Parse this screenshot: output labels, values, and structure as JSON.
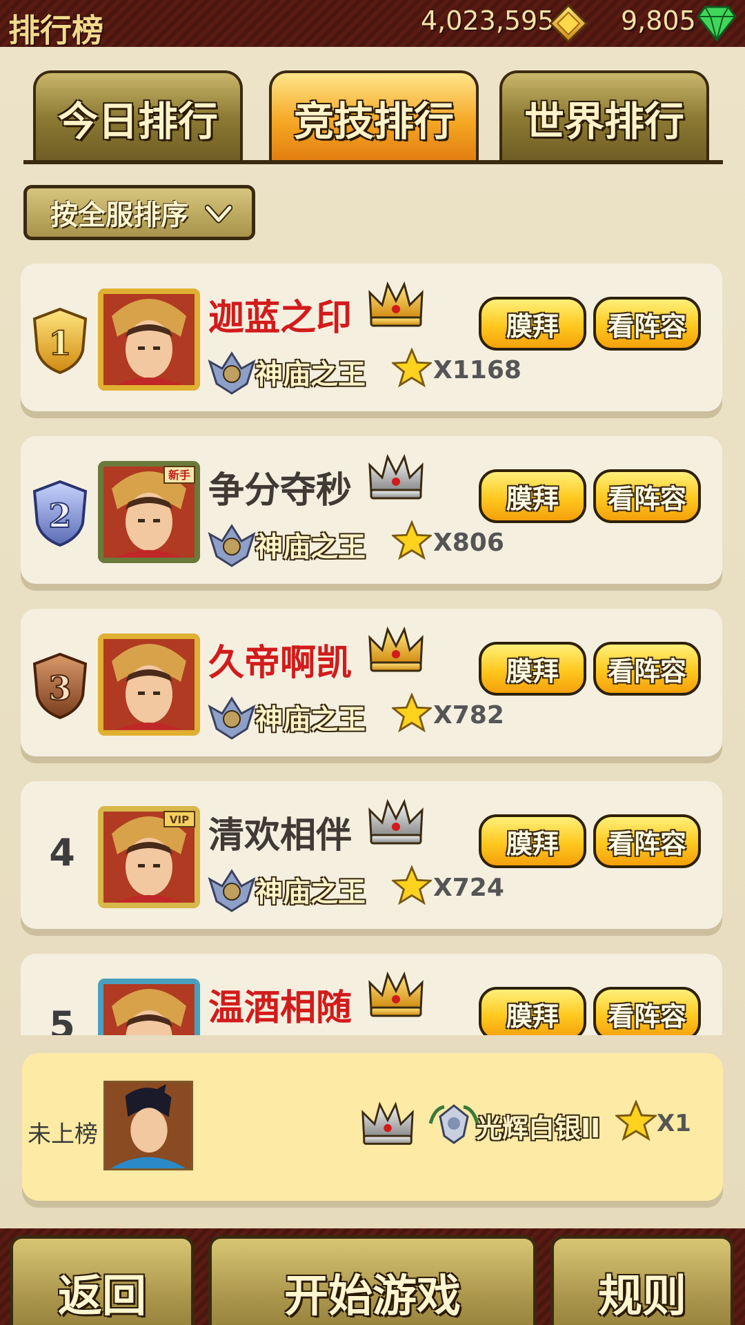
{
  "header": {
    "title": "排行榜",
    "gold": "4,023,595",
    "gems": "9,805"
  },
  "tabs": [
    {
      "label": "今日排行",
      "active": false
    },
    {
      "label": "竞技排行",
      "active": true
    },
    {
      "label": "世界排行",
      "active": false
    }
  ],
  "filter": {
    "selected": "按全服排序"
  },
  "rankings": [
    {
      "rank": "1",
      "name": "迦蓝之印",
      "name_color": "red",
      "crown": "gold-crown-icon",
      "title": "神庙之王",
      "stars": "X1168",
      "worship_label": "膜拜",
      "lineup_label": "看阵容"
    },
    {
      "rank": "2",
      "name": "争分夺秒",
      "name_color": "grey",
      "crown": "silver-crown-icon",
      "title": "神庙之王",
      "stars": "X806",
      "worship_label": "膜拜",
      "lineup_label": "看阵容",
      "avatar_badge": "新手"
    },
    {
      "rank": "3",
      "name": "久帝啊凯",
      "name_color": "red",
      "crown": "gold-crown-icon",
      "title": "神庙之王",
      "stars": "X782",
      "worship_label": "膜拜",
      "lineup_label": "看阵容"
    },
    {
      "rank": "4",
      "name": "清欢相伴",
      "name_color": "grey",
      "crown": "silver-crown-icon",
      "title": "神庙之王",
      "stars": "X724",
      "worship_label": "膜拜",
      "lineup_label": "看阵容",
      "avatar_badge": "VIP"
    },
    {
      "rank": "5",
      "name": "温酒相随",
      "name_color": "red",
      "crown": "gold-crown-icon",
      "worship_label": "膜拜",
      "lineup_label": "看阵容"
    }
  ],
  "my_rank": {
    "status": "未上榜",
    "crown": "silver-crown-icon",
    "title": "光辉白银II",
    "stars": "X1"
  },
  "footer": {
    "back_label": "返回",
    "start_label": "开始游戏",
    "rules_label": "规则"
  },
  "colors": {
    "accent_gold": "#ffc81e",
    "name_red": "#d21b1b",
    "panel_bg": "#f5efe0",
    "my_rank_bg": "#fdeaa4"
  }
}
